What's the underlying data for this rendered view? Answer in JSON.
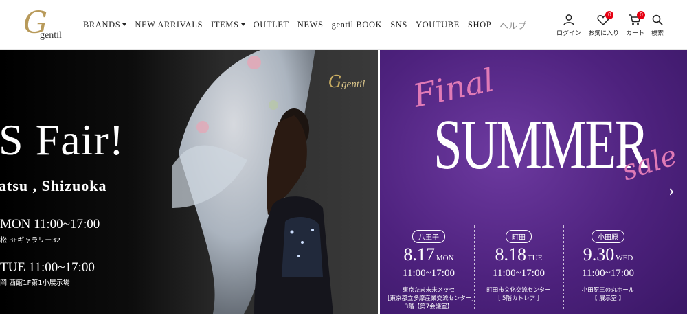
{
  "header": {
    "logo": {
      "mark": "G",
      "word": "gentil"
    },
    "nav": [
      {
        "label": "BRANDS",
        "dropdown": true
      },
      {
        "label": "NEW ARRIVALS",
        "dropdown": false
      },
      {
        "label": "ITEMS",
        "dropdown": true
      },
      {
        "label": "OUTLET",
        "dropdown": false
      },
      {
        "label": "NEWS",
        "dropdown": false
      },
      {
        "label": "gentil BOOK",
        "dropdown": false
      },
      {
        "label": "SNS",
        "dropdown": false
      },
      {
        "label": "YOUTUBE",
        "dropdown": false
      },
      {
        "label": "SHOP",
        "dropdown": false
      },
      {
        "label": "ヘルプ",
        "dropdown": false
      }
    ],
    "icons": {
      "login": {
        "label": "ログイン",
        "icon": "user-icon"
      },
      "favorites": {
        "label": "お気に入り",
        "icon": "heart-icon",
        "badge": "0"
      },
      "cart": {
        "label": "カート",
        "icon": "cart-icon",
        "badge": "0"
      },
      "search": {
        "label": "検索",
        "icon": "search-icon"
      }
    }
  },
  "hero": {
    "left": {
      "title": "S Fair!",
      "place": "atsu , Shizuoka",
      "date1": "MON  11:00~17:00",
      "venue1": "松  3Fギャラリー32",
      "date2": "TUE   11:00~17:00",
      "venue2": "岡  西館1F第1小展示場",
      "logo_mark": "G",
      "logo_word": "gentil"
    },
    "right": {
      "final": "Final",
      "summer": "SUMMER",
      "sale": "sale",
      "arrow": "›",
      "venues": [
        {
          "city": "八王子",
          "date": "8.17",
          "dow": "MON",
          "time": "11:00~17:00",
          "address": [
            "東京たま未来メッセ",
            "［東京都立多摩産業交流センター］",
            "3階【第7会議室】"
          ]
        },
        {
          "city": "町田",
          "date": "8.18",
          "dow": "TUE",
          "time": "11:00~17:00",
          "address": [
            "町田市文化交流センター",
            "［ 5階カトレア ］"
          ]
        },
        {
          "city": "小田原",
          "date": "9.30",
          "dow": "WED",
          "time": "11:00~17:00",
          "address": [
            "小田原三の丸ホール",
            "【 展示室 】"
          ]
        }
      ]
    }
  },
  "colors": {
    "badge": "#e60012",
    "accent_pink": "#e07ab6",
    "purple": "#4e227e"
  }
}
